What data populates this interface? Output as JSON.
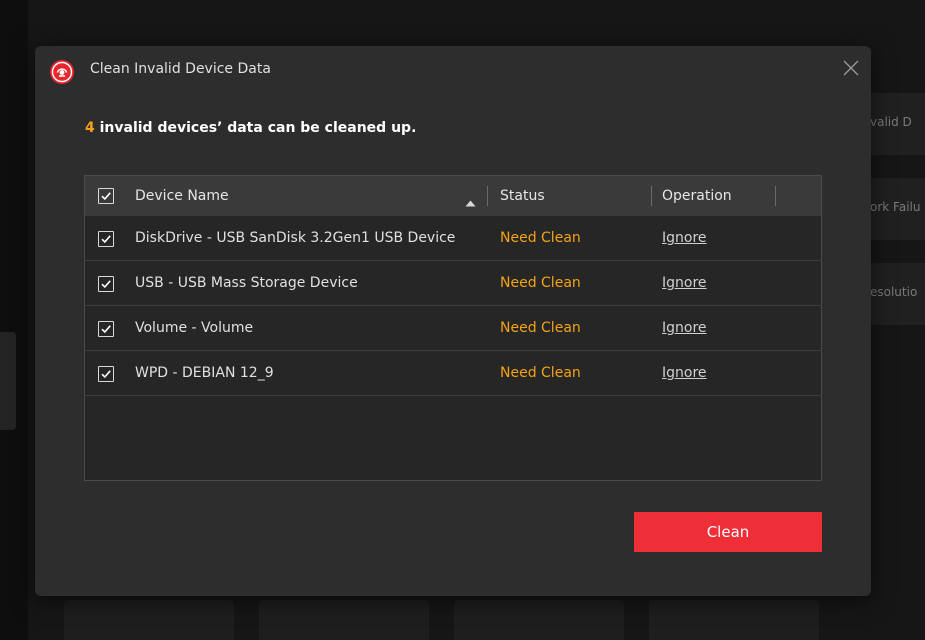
{
  "background": {
    "cards": [
      "valid D",
      "ork Failu",
      "esolutio"
    ]
  },
  "dialog": {
    "title": "Clean Invalid Device Data",
    "summary": {
      "count": "4",
      "text": " invalid devices’ data can be cleaned up."
    },
    "table": {
      "columns": {
        "name": "Device Name",
        "status": "Status",
        "operation": "Operation"
      },
      "header_checked": true,
      "rows": [
        {
          "name": "DiskDrive - USB  SanDisk 3.2Gen1 USB Device",
          "status": "Need Clean",
          "operation": "Ignore",
          "checked": true
        },
        {
          "name": "USB - USB Mass Storage Device",
          "status": "Need Clean",
          "operation": "Ignore",
          "checked": true
        },
        {
          "name": "Volume - Volume",
          "status": "Need Clean",
          "operation": "Ignore",
          "checked": true
        },
        {
          "name": "WPD - DEBIAN 12_9",
          "status": "Need Clean",
          "operation": "Ignore",
          "checked": true
        }
      ]
    },
    "clean_button": "Clean"
  },
  "colors": {
    "accent": "#ee2f38",
    "status": "#f5a214",
    "dialog_bg": "#2d2d2d"
  },
  "icons": [
    "brand-logo-icon",
    "close-icon",
    "sort-ascending-icon",
    "checkmark-icon"
  ]
}
